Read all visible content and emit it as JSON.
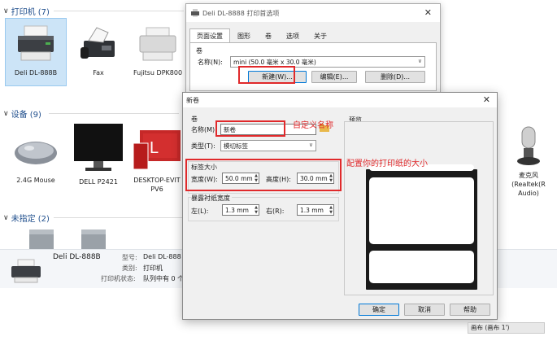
{
  "groups": {
    "printers": "打印机 (7)",
    "devices": "设备 (9)",
    "unspecified": "未指定 (2)"
  },
  "printers": [
    {
      "label": "Deli DL-888B"
    },
    {
      "label": "Fax"
    },
    {
      "label": "Fujitsu DPK800"
    }
  ],
  "devices": [
    {
      "label": "2.4G Mouse"
    },
    {
      "label": "DELL P2421"
    },
    {
      "label": "DESKTOP-EVIT",
      "label2": "PV6"
    },
    {
      "label": "麦克风",
      "label2": "(Realtek(R",
      "label3": "Audio)"
    }
  ],
  "details": {
    "name": "Deli DL-888B",
    "model_label": "型号:",
    "model_value": "Deli DL-888",
    "category_label": "类别:",
    "category_value": "打印机",
    "status_label": "打印机状态:",
    "status_value": "队列中有 0 个"
  },
  "print_options_dialog": {
    "title": "Deli DL-8888 打印首选项",
    "tabs": [
      "页面设置",
      "图形",
      "卷",
      "选项",
      "关于"
    ],
    "active_tab": 0,
    "roll_label": "卷",
    "name_label": "名称(N):",
    "name_value": "mini (50.0 毫米 x 30.0 毫米)",
    "new_button": "新建(W)...",
    "edit_button": "编辑(E)...",
    "delete_button": "删除(D)..."
  },
  "new_dialog": {
    "title": "新卷",
    "roll_group": "卷",
    "name_label": "名称(M):",
    "name_value": "新卷",
    "type_label": "类型(T):",
    "type_value": "模切标签",
    "label_size_group": "标签大小",
    "width_label": "宽度(W):",
    "width_value": "50.0 mm",
    "height_label": "高度(H):",
    "height_value": "30.0 mm",
    "exposed_group": "暴露衬纸宽度",
    "left_label": "左(L):",
    "left_value": "1.3 mm",
    "right_label": "右(R):",
    "right_value": "1.3 mm",
    "preview_label": "预览",
    "ok_button": "确定",
    "cancel_button": "取消",
    "help_button": "帮助"
  },
  "annotations": {
    "custom_name": "自定义名称",
    "configure_size": "配置你的打印纸的大小",
    "color": "#e0292b"
  },
  "statusbar": {
    "text": "画布 (画布 1')"
  }
}
